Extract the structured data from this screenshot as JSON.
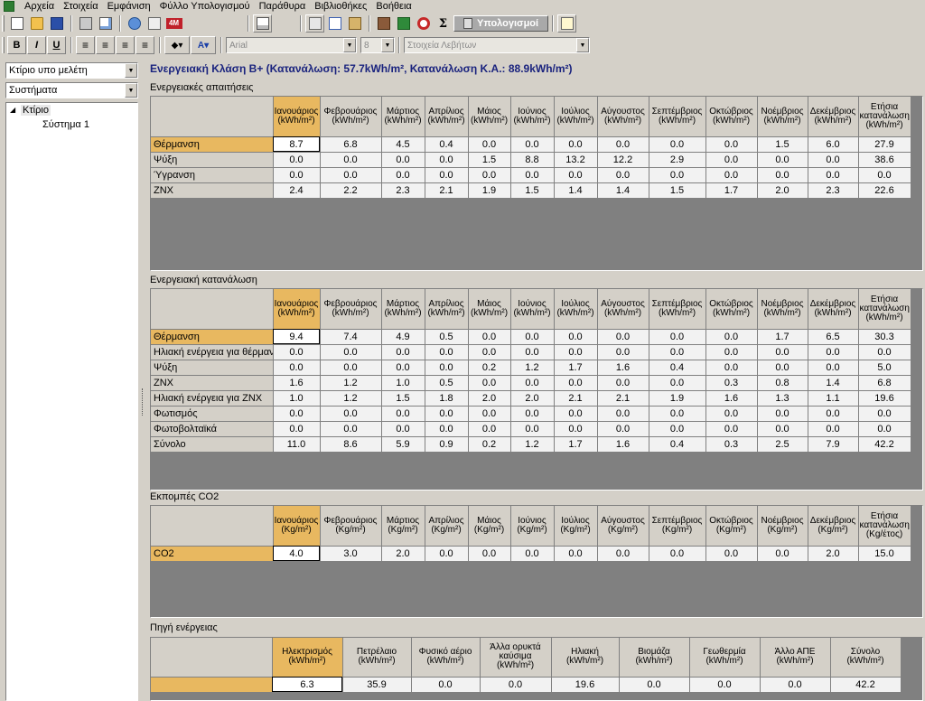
{
  "menu": [
    "Αρχεία",
    "Στοιχεία",
    "Εμφάνιση",
    "Φύλλο Υπολογισμού",
    "Παράθυρα",
    "Βιβλιοθήκες",
    "Βοήθεια"
  ],
  "toolbar": {
    "calc_label": "Υπολογισμοί",
    "badge_4m": "4M",
    "sigma": "Σ",
    "bold": "B",
    "italic": "I",
    "underline": "U",
    "font_name": "Arial",
    "font_size": "8",
    "style_combo": "Στοιχεία Λεβήτων",
    "font_color_glyph": "A"
  },
  "left": {
    "select_building": "Κτίριο υπο μελέτη",
    "select_systems": "Συστήματα",
    "tree_root": "Κτίριο",
    "tree_child": "Σύστημα 1"
  },
  "main": {
    "heading": "Ενεργειακή Κλάση Β+ (Κατανάλωση: 57.7kWh/m², Κατανάλωση Κ.Α.: 88.9kWh/m²)",
    "sections": [
      {
        "title": "Ενεργειακές απαιτήσεις",
        "columns": [
          "Ιανουάριος (kWh/m²)",
          "Φεβρουάριος (kWh/m²)",
          "Μάρτιος (kWh/m²)",
          "Απρίλιος (kWh/m²)",
          "Μάιος (kWh/m²)",
          "Ιούνιος (kWh/m²)",
          "Ιούλιος (kWh/m²)",
          "Αύγουστος (kWh/m²)",
          "Σεπτέμβριος (kWh/m²)",
          "Οκτώβριος (kWh/m²)",
          "Νοέμβριος (kWh/m²)",
          "Δεκέμβριος (kWh/m²)",
          "Ετήσια κατανάλωση (kWh/m²)"
        ],
        "rows": [
          {
            "label": "Θέρμανση",
            "values": [
              "8.7",
              "6.8",
              "4.5",
              "0.4",
              "0.0",
              "0.0",
              "0.0",
              "0.0",
              "0.0",
              "0.0",
              "1.5",
              "6.0",
              "27.9"
            ]
          },
          {
            "label": "Ψύξη",
            "values": [
              "0.0",
              "0.0",
              "0.0",
              "0.0",
              "1.5",
              "8.8",
              "13.2",
              "12.2",
              "2.9",
              "0.0",
              "0.0",
              "0.0",
              "38.6"
            ]
          },
          {
            "label": "Ύγρανση",
            "values": [
              "0.0",
              "0.0",
              "0.0",
              "0.0",
              "0.0",
              "0.0",
              "0.0",
              "0.0",
              "0.0",
              "0.0",
              "0.0",
              "0.0",
              "0.0"
            ]
          },
          {
            "label": "ΖΝΧ",
            "values": [
              "2.4",
              "2.2",
              "2.3",
              "2.1",
              "1.9",
              "1.5",
              "1.4",
              "1.4",
              "1.5",
              "1.7",
              "2.0",
              "2.3",
              "22.6"
            ]
          }
        ]
      },
      {
        "title": "Ενεργειακή κατανάλωση",
        "columns": [
          "Ιανουάριος (kWh/m²)",
          "Φεβρουάριος (kWh/m²)",
          "Μάρτιος (kWh/m²)",
          "Απρίλιος (kWh/m²)",
          "Μάιος (kWh/m²)",
          "Ιούνιος (kWh/m²)",
          "Ιούλιος (kWh/m²)",
          "Αύγουστος (kWh/m²)",
          "Σεπτέμβριος (kWh/m²)",
          "Οκτώβριος (kWh/m²)",
          "Νοέμβριος (kWh/m²)",
          "Δεκέμβριος (kWh/m²)",
          "Ετήσια κατανάλωση (kWh/m²)"
        ],
        "rows": [
          {
            "label": "Θέρμανση",
            "values": [
              "9.4",
              "7.4",
              "4.9",
              "0.5",
              "0.0",
              "0.0",
              "0.0",
              "0.0",
              "0.0",
              "0.0",
              "1.7",
              "6.5",
              "30.3"
            ]
          },
          {
            "label": "Ηλιακή ενέργεια για θέρμανση",
            "values": [
              "0.0",
              "0.0",
              "0.0",
              "0.0",
              "0.0",
              "0.0",
              "0.0",
              "0.0",
              "0.0",
              "0.0",
              "0.0",
              "0.0",
              "0.0"
            ]
          },
          {
            "label": "Ψύξη",
            "values": [
              "0.0",
              "0.0",
              "0.0",
              "0.0",
              "0.2",
              "1.2",
              "1.7",
              "1.6",
              "0.4",
              "0.0",
              "0.0",
              "0.0",
              "5.0"
            ]
          },
          {
            "label": "ΖΝΧ",
            "values": [
              "1.6",
              "1.2",
              "1.0",
              "0.5",
              "0.0",
              "0.0",
              "0.0",
              "0.0",
              "0.0",
              "0.3",
              "0.8",
              "1.4",
              "6.8"
            ]
          },
          {
            "label": "Ηλιακή ενέργεια για ΖΝΧ",
            "values": [
              "1.0",
              "1.2",
              "1.5",
              "1.8",
              "2.0",
              "2.0",
              "2.1",
              "2.1",
              "1.9",
              "1.6",
              "1.3",
              "1.1",
              "19.6"
            ]
          },
          {
            "label": "Φωτισμός",
            "values": [
              "0.0",
              "0.0",
              "0.0",
              "0.0",
              "0.0",
              "0.0",
              "0.0",
              "0.0",
              "0.0",
              "0.0",
              "0.0",
              "0.0",
              "0.0"
            ]
          },
          {
            "label": "Φωτοβολταϊκά",
            "values": [
              "0.0",
              "0.0",
              "0.0",
              "0.0",
              "0.0",
              "0.0",
              "0.0",
              "0.0",
              "0.0",
              "0.0",
              "0.0",
              "0.0",
              "0.0"
            ]
          },
          {
            "label": "Σύνολο",
            "values": [
              "11.0",
              "8.6",
              "5.9",
              "0.9",
              "0.2",
              "1.2",
              "1.7",
              "1.6",
              "0.4",
              "0.3",
              "2.5",
              "7.9",
              "42.2"
            ]
          }
        ]
      },
      {
        "title": "Εκπομπές CO2",
        "columns": [
          "Ιανουάριος (Kg/m²)",
          "Φεβρουάριος (Kg/m²)",
          "Μάρτιος (Kg/m²)",
          "Απρίλιος (Kg/m²)",
          "Μάιος (Kg/m²)",
          "Ιούνιος (Kg/m²)",
          "Ιούλιος (Kg/m²)",
          "Αύγουστος (Kg/m²)",
          "Σεπτέμβριος (Kg/m²)",
          "Οκτώβριος (Kg/m²)",
          "Νοέμβριος (Kg/m²)",
          "Δεκέμβριος (Kg/m²)",
          "Ετήσια κατανάλωση (Kg/έτος)"
        ],
        "rows": [
          {
            "label": "CO2",
            "values": [
              "4.0",
              "3.0",
              "2.0",
              "0.0",
              "0.0",
              "0.0",
              "0.0",
              "0.0",
              "0.0",
              "0.0",
              "0.0",
              "2.0",
              "15.0"
            ]
          }
        ]
      },
      {
        "title": "Πηγή ενέργειας",
        "columns": [
          "Ηλεκτρισμός (kWh/m²)",
          "Πετρέλαιο (kWh/m²)",
          "Φυσικό αέριο (kWh/m²)",
          "Άλλα ορυκτά καύσιμα (kWh/m²)",
          "Ηλιακή (kWh/m²)",
          "Βιομάζα (kWh/m²)",
          "Γεωθερμία (kWh/m²)",
          "Άλλο ΑΠΕ (kWh/m²)",
          "Σύνολο (kWh/m²)"
        ],
        "rows": [
          {
            "label": "",
            "values": [
              "6.3",
              "35.9",
              "0.0",
              "0.0",
              "19.6",
              "0.0",
              "0.0",
              "0.0",
              "42.2"
            ]
          }
        ]
      }
    ]
  }
}
